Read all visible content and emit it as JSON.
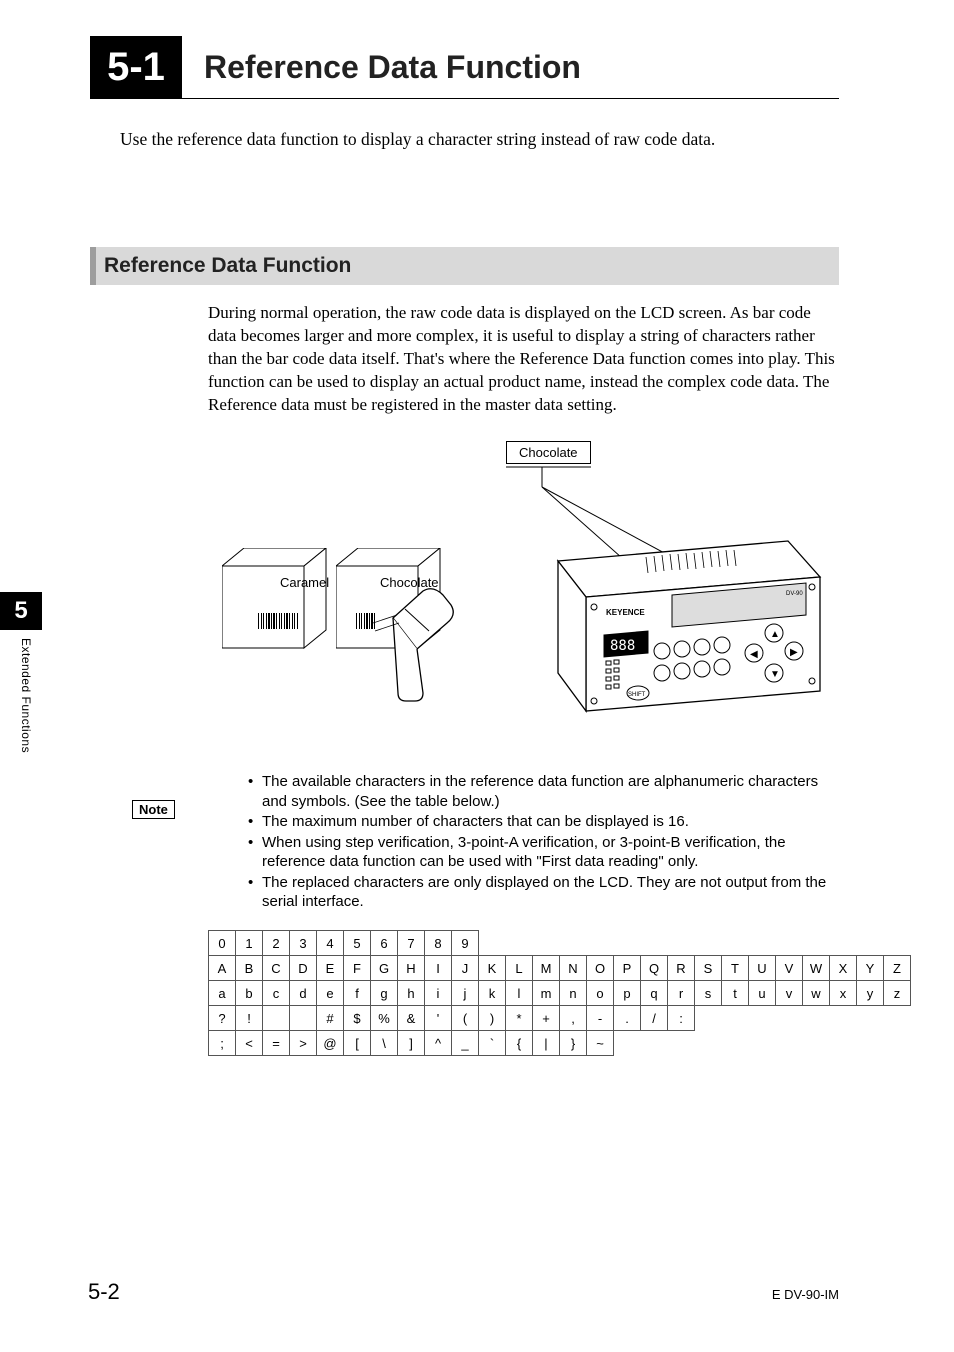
{
  "header": {
    "section_num": "5-1",
    "title": "Reference Data Function"
  },
  "intro": "Use the reference data function to display a character string instead of raw code data.",
  "section_heading": "Reference Data Function",
  "body": "During normal operation, the raw code data is displayed on the LCD screen. As bar code data becomes larger and more complex, it is useful to display a string of characters rather than the bar code data itself. That's where the Reference Data function comes into play. This function can be used to display an actual product name, instead the complex code data. The Reference data must be registered in the master data setting.",
  "figure": {
    "box1": "Caramel",
    "box2": "Chocolate",
    "callout": "Chocolate",
    "device_brand": "KEYENCE",
    "device_model": "DV-90",
    "device_seg": "888"
  },
  "sidebar": {
    "chapter": "5",
    "label": "Extended Functions"
  },
  "note_label": "Note",
  "bullets": [
    "The available characters in the reference data function are alphanumeric characters and symbols. (See the table below.)",
    "The maximum number of characters that can be displayed is 16.",
    "When using step verification, 3-point-A verification, or 3-point-B verification, the reference data function can be used with \"First data reading\" only.",
    "The replaced characters are only displayed on the LCD. They are not output from the serial interface."
  ],
  "char_table": [
    [
      "0",
      "1",
      "2",
      "3",
      "4",
      "5",
      "6",
      "7",
      "8",
      "9",
      "",
      "",
      "",
      "",
      "",
      "",
      "",
      "",
      "",
      "",
      "",
      "",
      "",
      "",
      "",
      ""
    ],
    [
      "A",
      "B",
      "C",
      "D",
      "E",
      "F",
      "G",
      "H",
      "I",
      "J",
      "K",
      "L",
      "M",
      "N",
      "O",
      "P",
      "Q",
      "R",
      "S",
      "T",
      "U",
      "V",
      "W",
      "X",
      "Y",
      "Z"
    ],
    [
      "a",
      "b",
      "c",
      "d",
      "e",
      "f",
      "g",
      "h",
      "i",
      "j",
      "k",
      "l",
      "m",
      "n",
      "o",
      "p",
      "q",
      "r",
      "s",
      "t",
      "u",
      "v",
      "w",
      "x",
      "y",
      "z"
    ],
    [
      "?",
      "!",
      "",
      "",
      "#",
      "$",
      "%",
      "&",
      "'",
      "(",
      ")",
      "*",
      "+",
      ",",
      "-",
      ".",
      "/",
      ":",
      "",
      "",
      "",
      "",
      "",
      "",
      "",
      ""
    ],
    [
      ";",
      "<",
      "=",
      ">",
      "@",
      "[",
      "\\",
      "]",
      "^",
      "_",
      "`",
      "{",
      "|",
      "}",
      "~",
      "",
      "",
      "",
      "",
      "",
      "",
      "",
      "",
      "",
      "",
      ""
    ]
  ],
  "char_table_lengths": [
    10,
    26,
    26,
    18,
    15
  ],
  "footer": {
    "left": "5-2",
    "right": "E DV-90-IM"
  }
}
